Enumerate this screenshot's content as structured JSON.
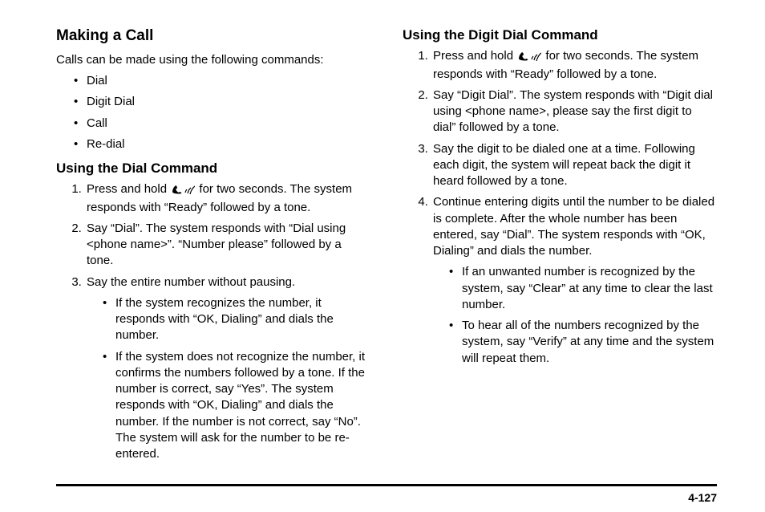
{
  "left": {
    "heading_main": "Making a Call",
    "intro": "Calls can be made using the following commands:",
    "commands": [
      "Dial",
      "Digit Dial",
      "Call",
      "Re-dial"
    ],
    "heading_sub": "Using the Dial Command",
    "steps": {
      "s1a": "Press and hold ",
      "s1b": " for two seconds. The system responds with “Ready” followed by a tone.",
      "s2": "Say “Dial”. The system responds with “Dial using <phone name>”. “Number please” followed by a tone.",
      "s3": "Say the entire number without pausing.",
      "s3_sub": [
        "If the system recognizes the number, it responds with “OK, Dialing” and dials the number.",
        "If the system does not recognize the number, it confirms the numbers followed by a tone. If the number is correct, say “Yes”. The system responds with “OK, Dialing” and dials the number. If the number is not correct, say “No”. The system will ask for the number to be re-entered."
      ]
    }
  },
  "right": {
    "heading_sub": "Using the Digit Dial Command",
    "steps": {
      "s1a": "Press and hold ",
      "s1b": " for two seconds. The system responds with “Ready” followed by a tone.",
      "s2": "Say “Digit Dial”. The system responds with “Digit dial using <phone name>, please say the first digit to dial” followed by a tone.",
      "s3": "Say the digit to be dialed one at a time. Following each digit, the system will repeat back the digit it heard followed by a tone.",
      "s4": "Continue entering digits until the number to be dialed is complete. After the whole number has been entered, say “Dial”. The system responds with “OK, Dialing” and dials the number.",
      "s4_sub": [
        "If an unwanted number is recognized by the system, say “Clear” at any time to clear the last number.",
        "To hear all of the numbers recognized by the system, say “Verify” at any time and the system will repeat them."
      ]
    }
  },
  "page_number": "4-127"
}
